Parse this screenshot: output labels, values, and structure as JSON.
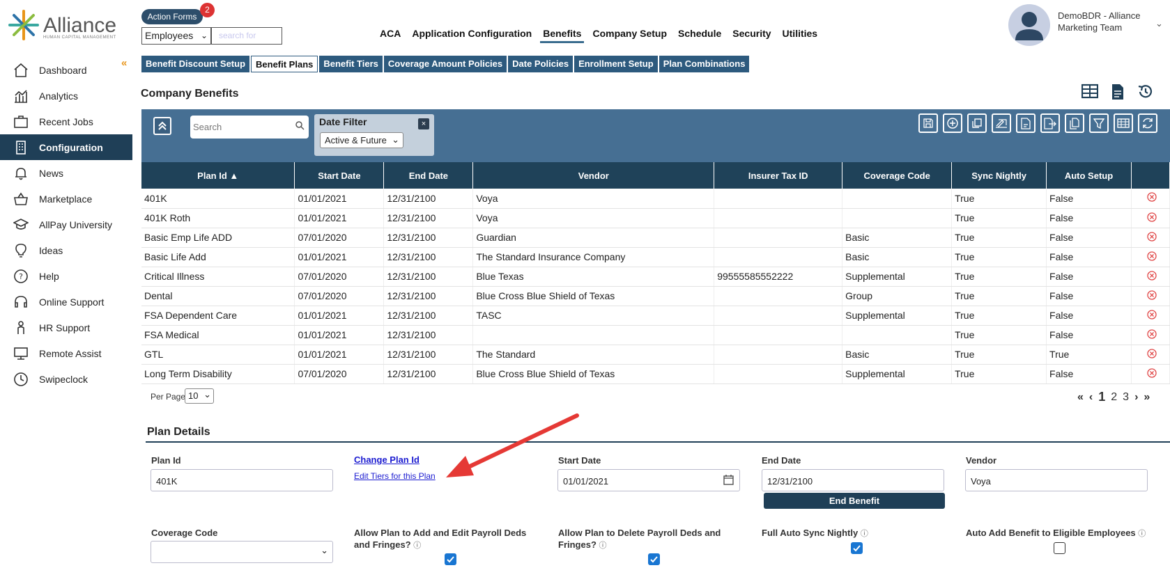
{
  "brand": {
    "name": "Alliance",
    "tagline": "HUMAN CAPITAL MANAGEMENT"
  },
  "action_forms": {
    "label": "Action Forms",
    "badge": "2"
  },
  "employee_search": {
    "select_value": "Employees",
    "placeholder": "search for"
  },
  "topnav": [
    "ACA",
    "Application Configuration",
    "Benefits",
    "Company Setup",
    "Schedule",
    "Security",
    "Utilities"
  ],
  "user": {
    "line1": "DemoBDR - Alliance",
    "line2": "Marketing Team"
  },
  "sidebar": [
    {
      "label": "Dashboard",
      "icon": "home-icon"
    },
    {
      "label": "Analytics",
      "icon": "analytics-icon"
    },
    {
      "label": "Recent Jobs",
      "icon": "briefcase-icon"
    },
    {
      "label": "Configuration",
      "icon": "building-icon"
    },
    {
      "label": "News",
      "icon": "bell-icon"
    },
    {
      "label": "Marketplace",
      "icon": "basket-icon"
    },
    {
      "label": "AllPay University",
      "icon": "graduation-cap-icon"
    },
    {
      "label": "Ideas",
      "icon": "lightbulb-icon"
    },
    {
      "label": "Help",
      "icon": "question-icon"
    },
    {
      "label": "Online Support",
      "icon": "headset-icon"
    },
    {
      "label": "HR Support",
      "icon": "person-icon"
    },
    {
      "label": "Remote Assist",
      "icon": "monitor-icon"
    },
    {
      "label": "Swipeclock",
      "icon": "clock-icon"
    }
  ],
  "tabs": [
    "Benefit Discount Setup",
    "Benefit Plans",
    "Benefit Tiers",
    "Coverage Amount Policies",
    "Date Policies",
    "Enrollment Setup",
    "Plan Combinations"
  ],
  "page_title": "Company Benefits",
  "toolbar": {
    "search_placeholder": "Search",
    "date_filter_title": "Date Filter",
    "date_filter_value": "Active & Future",
    "date_filter_close": "×"
  },
  "table": {
    "columns": [
      "Plan Id ▲",
      "Start Date",
      "End Date",
      "Vendor",
      "Insurer Tax ID",
      "Coverage Code",
      "Sync Nightly",
      "Auto Setup",
      ""
    ],
    "rows": [
      [
        "401K",
        "01/01/2021",
        "12/31/2100",
        "Voya",
        "",
        "",
        "True",
        "False"
      ],
      [
        "401K Roth",
        "01/01/2021",
        "12/31/2100",
        "Voya",
        "",
        "",
        "True",
        "False"
      ],
      [
        "Basic Emp Life ADD",
        "07/01/2020",
        "12/31/2100",
        "Guardian",
        "",
        "Basic",
        "True",
        "False"
      ],
      [
        "Basic Life Add",
        "01/01/2021",
        "12/31/2100",
        "The Standard Insurance Company",
        "",
        "Basic",
        "True",
        "False"
      ],
      [
        "Critical Illness",
        "07/01/2020",
        "12/31/2100",
        "Blue Texas",
        "99555585552222",
        "Supplemental",
        "True",
        "False"
      ],
      [
        "Dental",
        "07/01/2020",
        "12/31/2100",
        "Blue Cross Blue Shield of Texas",
        "",
        "Group",
        "True",
        "False"
      ],
      [
        "FSA Dependent Care",
        "01/01/2021",
        "12/31/2100",
        "TASC",
        "",
        "Supplemental",
        "True",
        "False"
      ],
      [
        "FSA Medical",
        "01/01/2021",
        "12/31/2100",
        "",
        "",
        "",
        "True",
        "False"
      ],
      [
        "GTL",
        "01/01/2021",
        "12/31/2100",
        "The Standard",
        "",
        "Basic",
        "True",
        "True"
      ],
      [
        "Long Term Disability",
        "07/01/2020",
        "12/31/2100",
        "Blue Cross Blue Shield of Texas",
        "",
        "Supplemental",
        "True",
        "False"
      ]
    ]
  },
  "pagination": {
    "per_page_label": "Per Page",
    "per_page_value": "10",
    "current": "1",
    "pages": [
      "2",
      "3"
    ]
  },
  "plan_details": {
    "title": "Plan Details",
    "plan_id_label": "Plan Id",
    "plan_id_value": "401K",
    "change_plan_link": "Change Plan Id",
    "edit_tiers_link": "Edit Tiers for this Plan",
    "start_date_label": "Start Date",
    "start_date_value": "01/01/2021",
    "end_date_label": "End Date",
    "end_date_value": "12/31/2100",
    "end_benefit_button": "End Benefit",
    "vendor_label": "Vendor",
    "vendor_value": "Voya",
    "coverage_code_label": "Coverage Code",
    "allow_add_label_1": "Allow Plan to Add and Edit Payroll Deds",
    "allow_add_label_2": "and Fringes?",
    "allow_delete_label_1": "Allow Plan to Delete Payroll Deds and",
    "allow_delete_label_2": "Fringes?",
    "full_sync_label": "Full Auto Sync Nightly",
    "auto_add_label": "Auto Add Benefit to Eligible Employees",
    "allow_add_checked": true,
    "allow_delete_checked": true,
    "full_sync_checked": true,
    "auto_add_checked": false
  },
  "colors": {
    "nav_dark": "#1f3f57",
    "toolbar": "#466f93",
    "tab": "#2d5a7e",
    "accent_orange": "#e8951a",
    "arrow_red": "#e53935"
  }
}
